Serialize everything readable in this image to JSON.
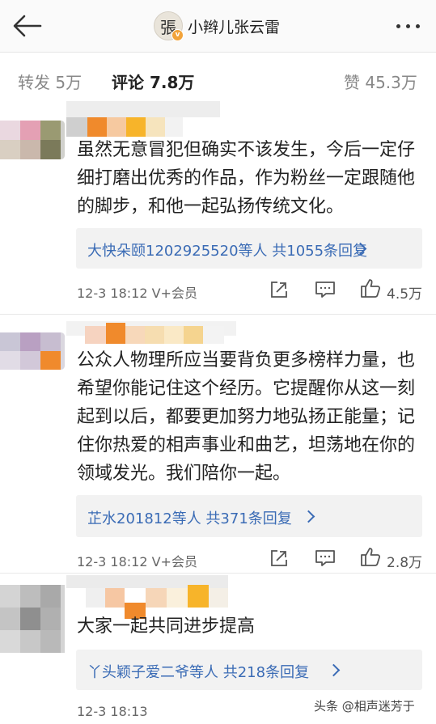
{
  "header": {
    "title": "小辫儿张云雷",
    "avatar_glyph": "張"
  },
  "stats": {
    "repost": "转发 5万",
    "comments": "评论 7.8万",
    "likes": "赞 45.3万"
  },
  "comments": [
    {
      "text": "虽然无意冒犯但确实不该发生，今后一定仔细打磨出优秀的作品，作为粉丝一定跟随他的脚步，和他一起弘扬传统文化。",
      "replies": "大快朵颐1202925520等人 共1055条回复",
      "time": "12-3 18:12",
      "vip": "V+会员",
      "likes": "4.5万"
    },
    {
      "text": "公众人物理所应当要背负更多榜样力量，也希望你能记住这个经历。它提醒你从这一刻起到以后，都要更加努力地弘扬正能量；记住你热爱的相声事业和曲艺，坦荡地在你的领域发光。我们陪你一起。",
      "replies": "芷水201812等人 共371条回复",
      "time": "12-3 18:12",
      "vip": "V+会员",
      "likes": "2.8万"
    },
    {
      "text": "大家一起共同进步提高",
      "replies": "丫头颖子爱二爷等人 共218条回复",
      "time": "12-3 18:13"
    }
  ],
  "watermark": "头条 @相声迷芳于"
}
